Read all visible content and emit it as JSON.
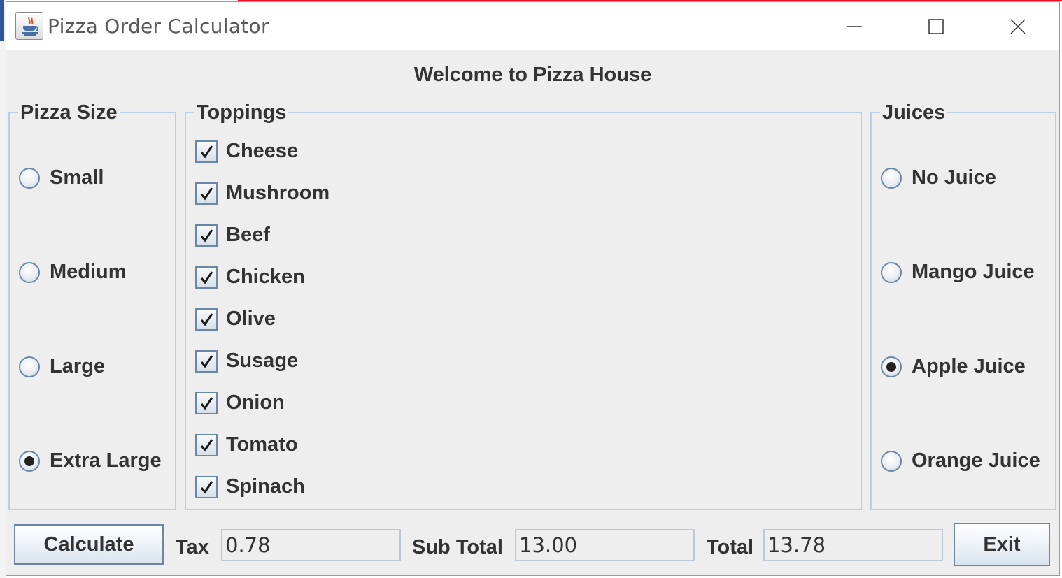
{
  "window": {
    "title": "Pizza Order Calculator",
    "icon": "java-cup-icon",
    "controls": [
      "minimize-icon",
      "maximize-icon",
      "close-icon"
    ]
  },
  "heading": "Welcome to Pizza House",
  "pizza_size": {
    "title": "Pizza Size",
    "options": [
      {
        "label": "Small",
        "selected": false
      },
      {
        "label": "Medium",
        "selected": false
      },
      {
        "label": "Large",
        "selected": false
      },
      {
        "label": "Extra Large",
        "selected": true
      }
    ]
  },
  "toppings": {
    "title": "Toppings",
    "items": [
      {
        "label": "Cheese",
        "checked": true
      },
      {
        "label": "Mushroom",
        "checked": true
      },
      {
        "label": "Beef",
        "checked": true
      },
      {
        "label": "Chicken",
        "checked": true
      },
      {
        "label": "Olive",
        "checked": true
      },
      {
        "label": "Susage",
        "checked": true
      },
      {
        "label": "Onion",
        "checked": true
      },
      {
        "label": "Tomato",
        "checked": true
      },
      {
        "label": "Spinach",
        "checked": true
      }
    ]
  },
  "juices": {
    "title": "Juices",
    "options": [
      {
        "label": "No Juice",
        "selected": false
      },
      {
        "label": "Mango Juice",
        "selected": false
      },
      {
        "label": "Apple Juice",
        "selected": true
      },
      {
        "label": "Orange Juice",
        "selected": false
      }
    ]
  },
  "footer": {
    "calculate_label": "Calculate",
    "tax_label": "Tax",
    "tax_value": "0.78",
    "subtotal_label": "Sub Total",
    "subtotal_value": "13.00",
    "total_label": "Total",
    "total_value": "13.78",
    "exit_label": "Exit"
  },
  "colors": {
    "panel_bg": "#eeeeee",
    "group_border": "#b8cfe5",
    "text": "#333333"
  }
}
